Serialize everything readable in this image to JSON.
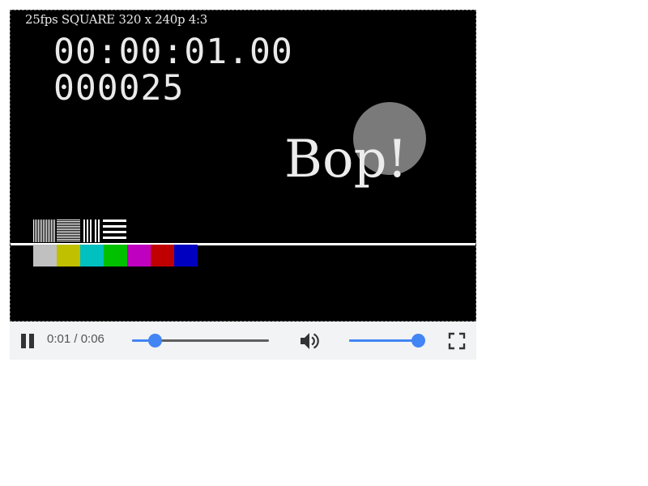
{
  "video": {
    "info_overlay": "25fps SQUARE 320 x 240p 4:3",
    "timecode": "00:00:01.00",
    "frame_counter": "000025",
    "caption": "Bop!",
    "colors": {
      "background": "#000000",
      "circle": "#7a7a7a",
      "scan_line": "#ffffff",
      "color_bars": [
        "#c0c0c0",
        "#c0c000",
        "#00c0c0",
        "#00c000",
        "#c000c0",
        "#c00000",
        "#0000c0"
      ]
    }
  },
  "controls": {
    "play_pause_icon": "pause-icon",
    "time_display": "0:01 / 0:06",
    "seek_progress": 0.167,
    "volume_icon": "volume-up-icon",
    "volume_level": 1.0,
    "fullscreen_icon": "fullscreen-icon",
    "accent_color": "#4285f4",
    "bar_color": "#f1f3f4"
  }
}
